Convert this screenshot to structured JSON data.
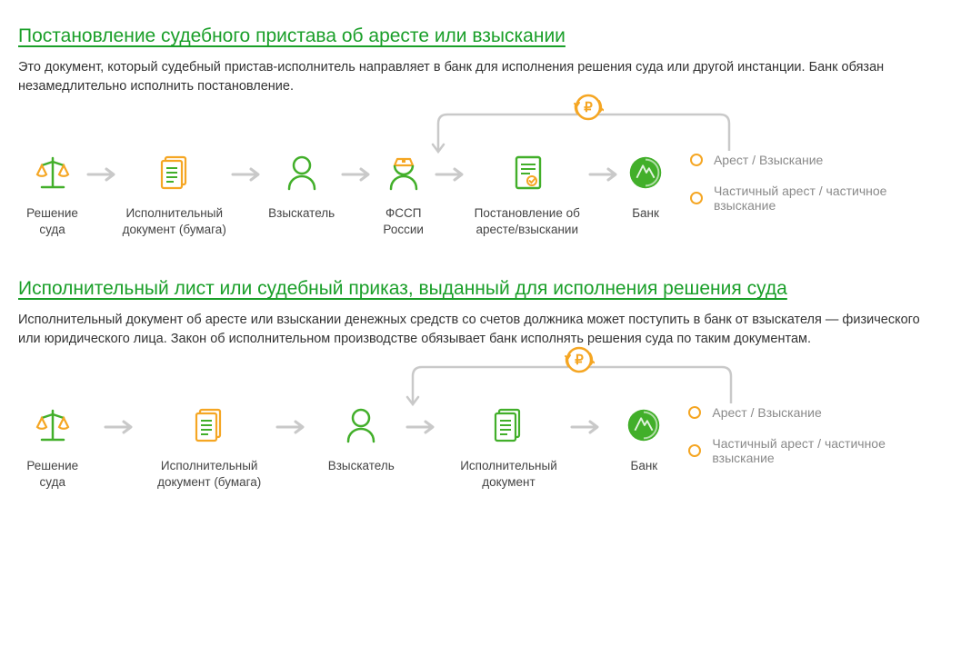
{
  "sections": [
    {
      "title": "Постановление судебного пристава об аресте или взыскании",
      "desc": "Это документ, который судебный пристав-исполнитель направляет в банк для исполнения решения суда или другой инстанции. Банк обязан незамедлительно исполнить постановление.",
      "steps": [
        {
          "icon": "scales",
          "label": "Решение суда"
        },
        {
          "icon": "docs",
          "label": "Исполнительный документ (бумага)"
        },
        {
          "icon": "person",
          "label": "Взыскатель"
        },
        {
          "icon": "officer",
          "label": "ФССП России"
        },
        {
          "icon": "order",
          "label": "Постановление об аресте/взыскании"
        },
        {
          "icon": "bank",
          "label": "Банк"
        }
      ],
      "outcomes": [
        "Арест / Взыскание",
        "Частичный арест / частичное взыскание"
      ],
      "loop_from_index": 5,
      "loop_to_index": 3
    },
    {
      "title": "Исполнительный лист или судебный приказ, выданный для исполнения решения суда",
      "desc": "Исполнительный документ об аресте или взыскании денежных средств со счетов должника может поступить в банк от взыскателя — физического или юридического лица. Закон об исполнительном производстве обязывает банк исполнять решения суда по таким документам.",
      "steps": [
        {
          "icon": "scales",
          "label": "Решение суда"
        },
        {
          "icon": "docs",
          "label": "Исполнительный документ (бумага)"
        },
        {
          "icon": "person",
          "label": "Взыскатель"
        },
        {
          "icon": "docs2",
          "label": "Исполнительный документ"
        },
        {
          "icon": "bank",
          "label": "Банк"
        }
      ],
      "outcomes": [
        "Арест / Взыскание",
        "Частичный арест / частичное взыскание"
      ],
      "loop_from_index": 4,
      "loop_to_index": 2
    }
  ],
  "colors": {
    "green": "#42af2a",
    "orange": "#f5a623",
    "grey": "#c9c9c9",
    "text_muted": "#8a8a8a"
  }
}
